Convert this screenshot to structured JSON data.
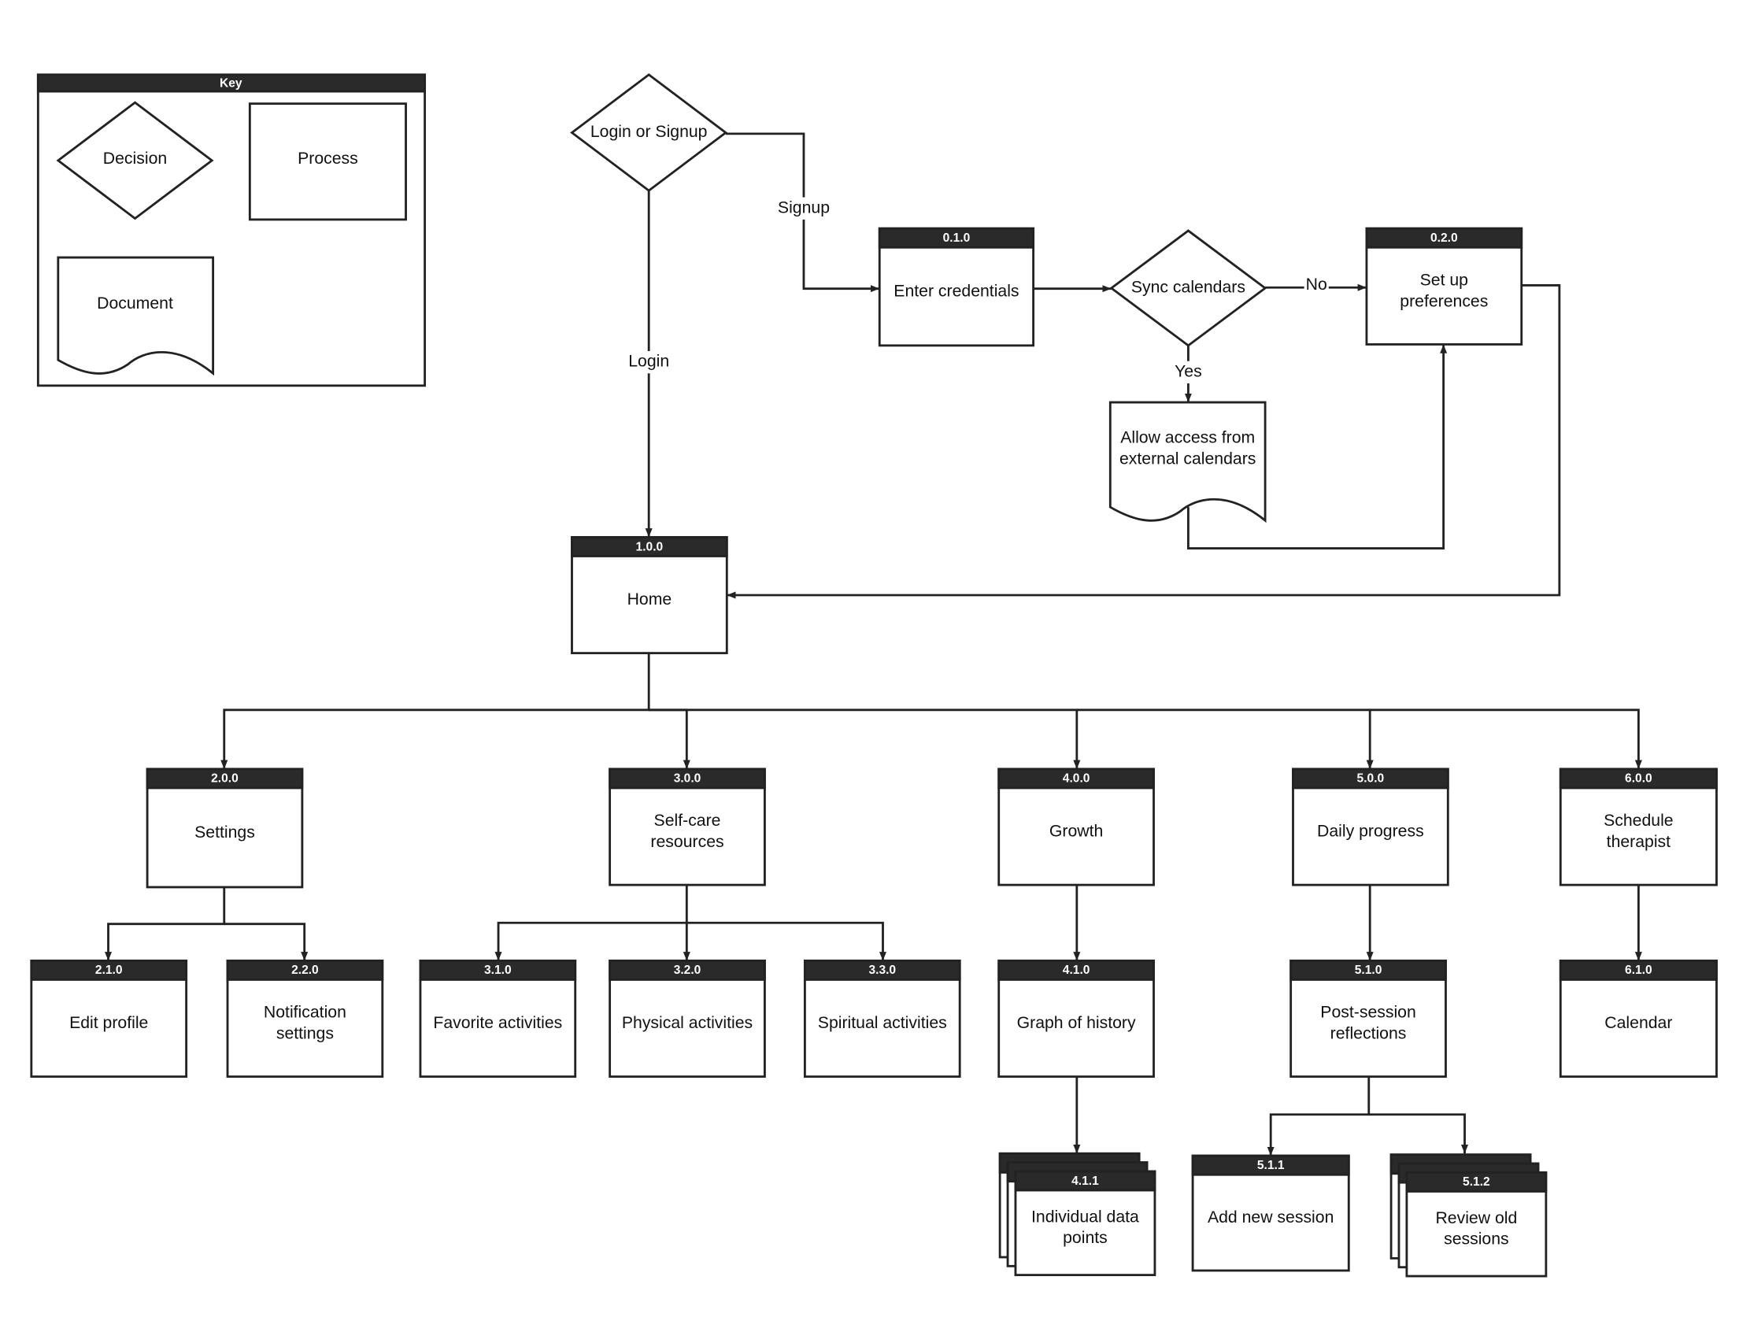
{
  "key": {
    "title": "Key",
    "decision": "Decision",
    "process": "Process",
    "document": "Document"
  },
  "nodes": {
    "start": {
      "type": "decision",
      "lines": [
        "Login or Signup"
      ]
    },
    "creds": {
      "type": "process",
      "id": "0.1.0",
      "lines": [
        "Enter credentials"
      ]
    },
    "sync": {
      "type": "decision",
      "lines": [
        "Sync calendars"
      ]
    },
    "prefs": {
      "type": "process",
      "id": "0.2.0",
      "lines": [
        "Set up",
        "preferences"
      ]
    },
    "access": {
      "type": "document",
      "lines": [
        "Allow access from",
        "external calendars"
      ]
    },
    "home": {
      "type": "process",
      "id": "1.0.0",
      "lines": [
        "Home"
      ]
    },
    "settings": {
      "type": "process",
      "id": "2.0.0",
      "lines": [
        "Settings"
      ]
    },
    "selfcare": {
      "type": "process",
      "id": "3.0.0",
      "lines": [
        "Self-care",
        "resources"
      ]
    },
    "growth": {
      "type": "process",
      "id": "4.0.0",
      "lines": [
        "Growth"
      ]
    },
    "daily": {
      "type": "process",
      "id": "5.0.0",
      "lines": [
        "Daily progress"
      ]
    },
    "therapist": {
      "type": "process",
      "id": "6.0.0",
      "lines": [
        "Schedule",
        "therapist"
      ]
    },
    "editprofile": {
      "type": "process",
      "id": "2.1.0",
      "lines": [
        "Edit profile"
      ]
    },
    "notif": {
      "type": "process",
      "id": "2.2.0",
      "lines": [
        "Notification",
        "settings"
      ]
    },
    "favorite": {
      "type": "process",
      "id": "3.1.0",
      "lines": [
        "Favorite activities"
      ]
    },
    "physical": {
      "type": "process",
      "id": "3.2.0",
      "lines": [
        "Physical activities"
      ]
    },
    "spiritual": {
      "type": "process",
      "id": "3.3.0",
      "lines": [
        "Spiritual activities"
      ]
    },
    "graph": {
      "type": "process",
      "id": "4.1.0",
      "lines": [
        "Graph of history"
      ]
    },
    "postsession": {
      "type": "process",
      "id": "5.1.0",
      "lines": [
        "Post-session",
        "reflections"
      ]
    },
    "calendar": {
      "type": "process",
      "id": "6.1.0",
      "lines": [
        "Calendar"
      ]
    },
    "datapoints": {
      "type": "process-stack",
      "id": "4.1.1",
      "lines": [
        "Individual data",
        "points"
      ]
    },
    "addsession": {
      "type": "process",
      "id": "5.1.1",
      "lines": [
        "Add new session"
      ]
    },
    "reviewsessions": {
      "type": "process-stack",
      "id": "5.1.2",
      "lines": [
        "Review old",
        "sessions"
      ]
    }
  },
  "edge_labels": {
    "login": "Login",
    "signup": "Signup",
    "no": "No",
    "yes": "Yes"
  },
  "colors": {
    "stroke": "#222222",
    "header": "#2a2a2a",
    "background": "#ffffff"
  }
}
